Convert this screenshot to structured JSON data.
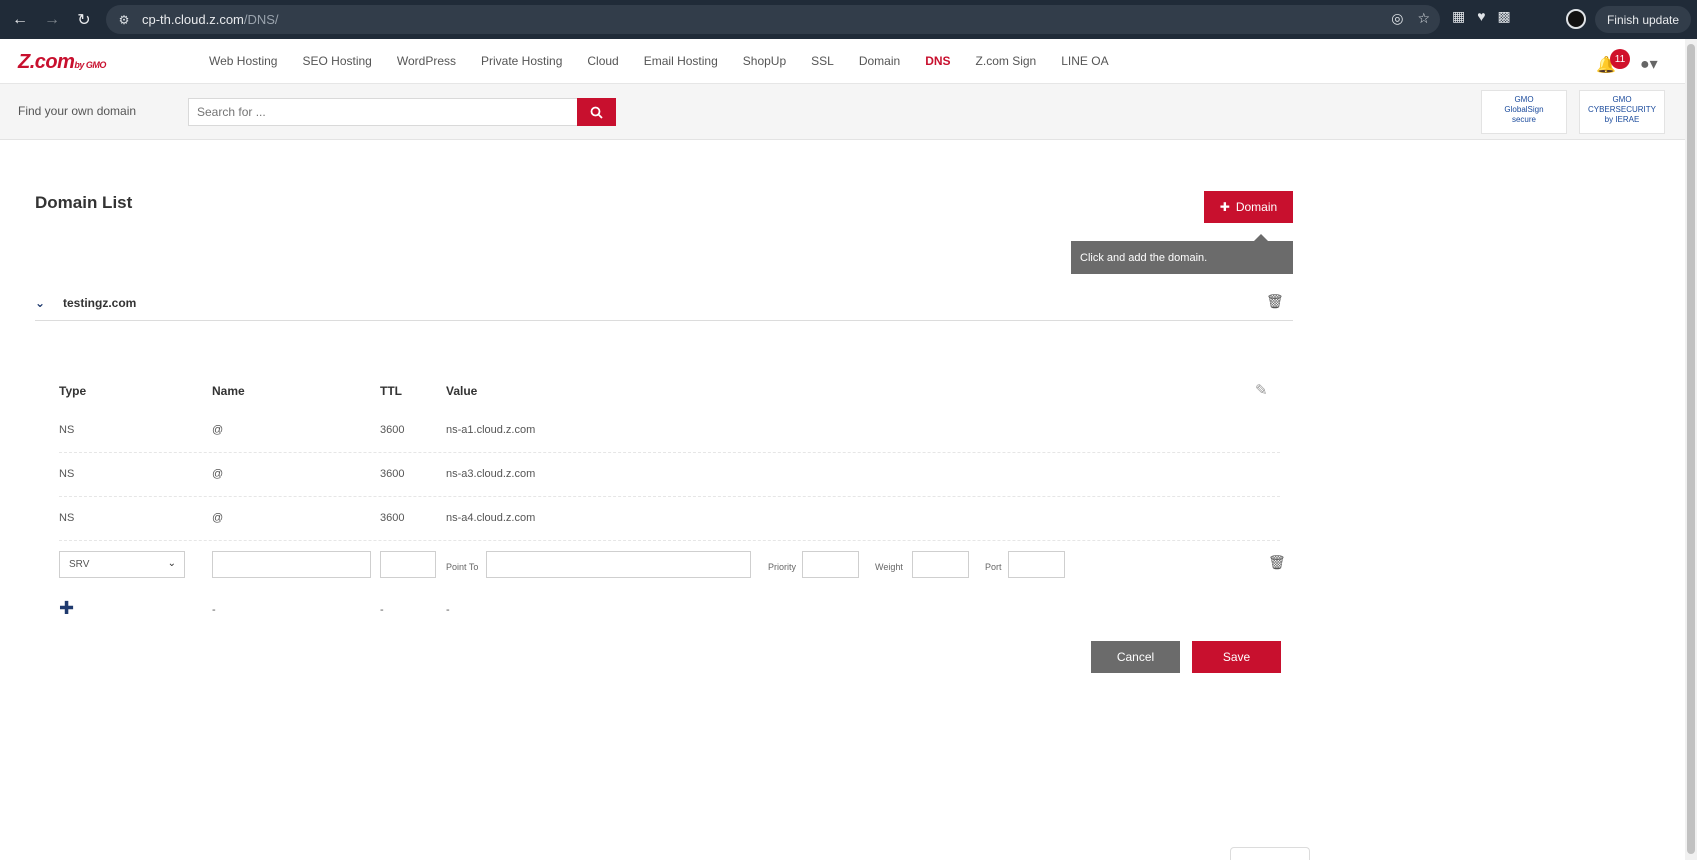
{
  "browser": {
    "url_host": "cp-th.cloud.z.com",
    "url_path": "/DNS/",
    "finish_update": "Finish update"
  },
  "header": {
    "logo": "Z.com",
    "logo_by": "by GMO",
    "nav": [
      {
        "label": "Web Hosting"
      },
      {
        "label": "SEO Hosting"
      },
      {
        "label": "WordPress"
      },
      {
        "label": "Private Hosting"
      },
      {
        "label": "Cloud"
      },
      {
        "label": "Email Hosting"
      },
      {
        "label": "ShopUp"
      },
      {
        "label": "SSL"
      },
      {
        "label": "Domain"
      },
      {
        "label": "DNS"
      },
      {
        "label": "Z.com Sign"
      },
      {
        "label": "LINE OA"
      }
    ],
    "notification_count": "11"
  },
  "search": {
    "label": "Find your own domain",
    "placeholder": "Search for ..."
  },
  "badges": {
    "globalsign_title": "GMO",
    "globalsign_line1": "GlobalSign",
    "globalsign_line2": "secure",
    "ierae_title": "GMO",
    "ierae_line1": "CYBERSECURITY",
    "ierae_line2": "by IERAE"
  },
  "page": {
    "title": "Domain List",
    "add_domain_label": "Domain",
    "tooltip": "Click and add the domain.",
    "domain_name": "testingz.com"
  },
  "records": {
    "columns": {
      "type": "Type",
      "name": "Name",
      "ttl": "TTL",
      "value": "Value"
    },
    "rows": [
      {
        "type": "NS",
        "name": "@",
        "ttl": "3600",
        "value": "ns-a1.cloud.z.com"
      },
      {
        "type": "NS",
        "name": "@",
        "ttl": "3600",
        "value": "ns-a3.cloud.z.com"
      },
      {
        "type": "NS",
        "name": "@",
        "ttl": "3600",
        "value": "ns-a4.cloud.z.com"
      }
    ],
    "edit": {
      "type_selected": "SRV",
      "point_to_label": "Point To",
      "priority_label": "Priority",
      "weight_label": "Weight",
      "port_label": "Port"
    },
    "add_row": {
      "name": "-",
      "ttl": "-",
      "value": "-"
    }
  },
  "actions": {
    "cancel": "Cancel",
    "save": "Save"
  }
}
